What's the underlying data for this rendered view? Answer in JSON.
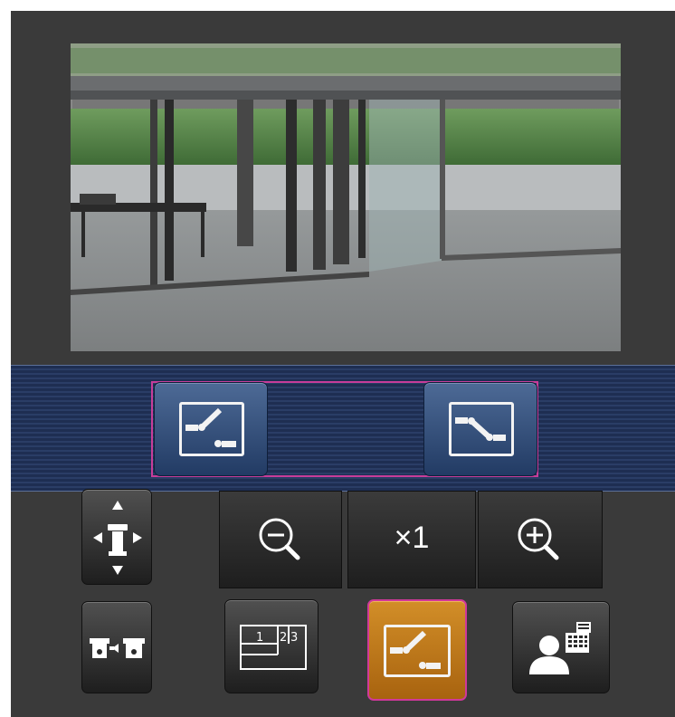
{
  "camera": {
    "view": "live-image"
  },
  "zoom": {
    "out_icon": "zoom-out-icon",
    "level": "×1",
    "in_icon": "zoom-in-icon"
  },
  "preset": {
    "left_icon": "preset-left-icon",
    "right_icon": "preset-right-icon"
  },
  "controls": {
    "pan_tilt_icon": "pan-tilt-icon",
    "camera_switch_icon": "camera-switch-icon",
    "multi_screen_icon": "multi-screen-icon",
    "preset_toggle_icon": "preset-toggle-icon",
    "user_icon": "user-icon",
    "multi_screen_labels": [
      "1",
      "2",
      "3"
    ]
  },
  "colors": {
    "background": "#3a3a3a",
    "band": "#1e2e52",
    "accent_orange": "#c47f1f",
    "highlight": "#c73d9a"
  }
}
